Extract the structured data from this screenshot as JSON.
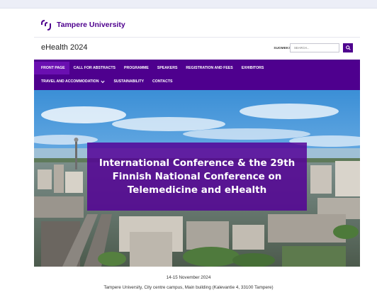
{
  "logo": {
    "text": "Tampere University",
    "icon": "tampere-bracket-logo-icon"
  },
  "site": {
    "title": "eHealth 2024",
    "language_link": "SUOMEKSI"
  },
  "search": {
    "placeholder": "SEARCH...",
    "icon": "search-icon"
  },
  "nav": {
    "row1": [
      {
        "label": "FRONT PAGE",
        "active": true
      },
      {
        "label": "CALL FOR ABSTRACTS"
      },
      {
        "label": "PROGRAMME"
      },
      {
        "label": "SPEAKERS"
      },
      {
        "label": "REGISTRATION AND FEES"
      },
      {
        "label": "EXHIBITORS"
      }
    ],
    "row2": [
      {
        "label": "TRAVEL AND ACCOMMODATION",
        "icon": "chevron-down-icon"
      },
      {
        "label": "SUSTAINABILITY"
      },
      {
        "label": "CONTACTS"
      }
    ]
  },
  "hero": {
    "title": "International Conference & the 29th\nFinnish National Conference on\nTelemedicine and eHealth"
  },
  "event": {
    "dates": "14-15 November 2024",
    "venue": "Tampere University, City centre campus, Main building (Kalevantie 4, 33100 Tampere)"
  },
  "colors": {
    "brand": "#4e008e",
    "hero_overlay": "#5a0096"
  }
}
